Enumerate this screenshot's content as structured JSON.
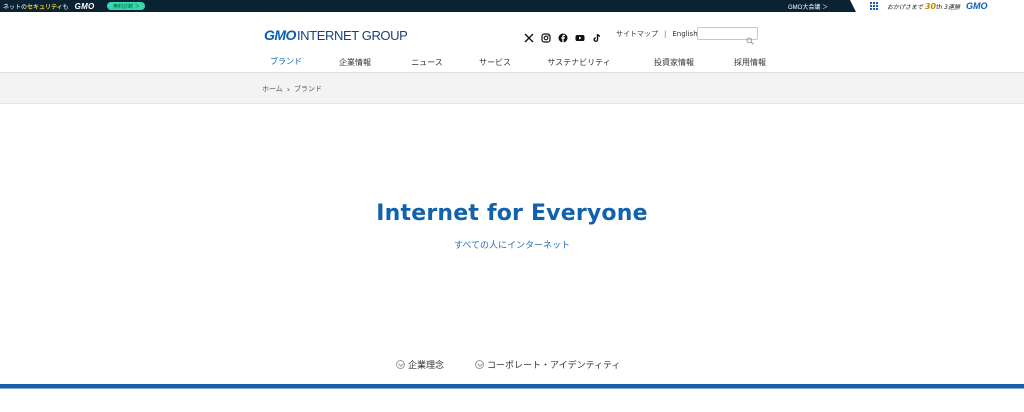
{
  "promo": {
    "left_text_pre": "ネットの",
    "left_text_hl": "セキュリティ",
    "left_text_post": "も",
    "left_logo": "GMO",
    "pill_label": "無料診断 ＞",
    "meeting_label": "GMO大会議 ＞",
    "thanks_pre": "おかげさまで",
    "thanks_num": "30",
    "thanks_post": "th 3連勝",
    "right_logo": "GMO"
  },
  "header": {
    "logo_gmo": "GMO",
    "logo_rest": "INTERNET GROUP",
    "social": [
      "x-icon",
      "instagram-icon",
      "facebook-icon",
      "youtube-icon",
      "tiktok-icon"
    ],
    "sitemap": "サイトマップ",
    "separator": "|",
    "english": "English",
    "search_placeholder": ""
  },
  "nav": {
    "tabs": [
      {
        "label": "ブランド",
        "active": true
      },
      {
        "label": "企業情報",
        "active": false
      },
      {
        "label": "ニュース",
        "active": false
      },
      {
        "label": "サービス",
        "active": false
      },
      {
        "label": "サステナビリティ",
        "active": false
      },
      {
        "label": "投資家情報",
        "active": false
      },
      {
        "label": "採用情報",
        "active": false
      }
    ]
  },
  "breadcrumb": {
    "home": "ホーム",
    "current": "ブランド"
  },
  "hero": {
    "title": "Internet for Everyone",
    "subtitle": "すべての人にインターネット"
  },
  "anchors": [
    {
      "label": "企業理念"
    },
    {
      "label": "コーポレート・アイデンティティ"
    }
  ],
  "colors": {
    "brand_blue": "#0a5db1",
    "hero_blue": "#1162ac",
    "promo_dark": "#0a2232",
    "pill_green": "#38d7b0"
  }
}
